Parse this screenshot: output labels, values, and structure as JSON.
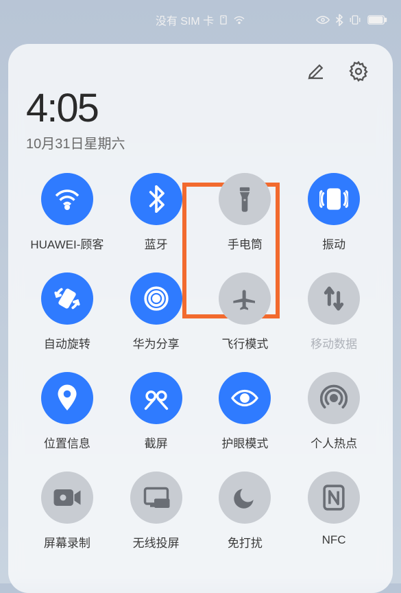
{
  "status": {
    "sim_text": "没有 SIM 卡"
  },
  "clock": "4:05",
  "date": "10月31日星期六",
  "tiles": [
    {
      "icon": "wifi",
      "label": "HUAWEI-顾客",
      "state": "on"
    },
    {
      "icon": "bluetooth",
      "label": "蓝牙",
      "state": "on"
    },
    {
      "icon": "flashlight",
      "label": "手电筒",
      "state": "off"
    },
    {
      "icon": "vibrate",
      "label": "振动",
      "state": "on"
    },
    {
      "icon": "rotate",
      "label": "自动旋转",
      "state": "on"
    },
    {
      "icon": "share",
      "label": "华为分享",
      "state": "on"
    },
    {
      "icon": "airplane",
      "label": "飞行模式",
      "state": "off"
    },
    {
      "icon": "mobiledata",
      "label": "移动数据",
      "state": "off",
      "dim": true
    },
    {
      "icon": "location",
      "label": "位置信息",
      "state": "on"
    },
    {
      "icon": "screenshot",
      "label": "截屏",
      "state": "on"
    },
    {
      "icon": "eyecare",
      "label": "护眼模式",
      "state": "on"
    },
    {
      "icon": "hotspot",
      "label": "个人热点",
      "state": "off"
    },
    {
      "icon": "record",
      "label": "屏幕录制",
      "state": "off"
    },
    {
      "icon": "cast",
      "label": "无线投屏",
      "state": "off"
    },
    {
      "icon": "dnd",
      "label": "免打扰",
      "state": "off"
    },
    {
      "icon": "nfc",
      "label": "NFC",
      "state": "off"
    }
  ],
  "highlight_tile_index": 2
}
